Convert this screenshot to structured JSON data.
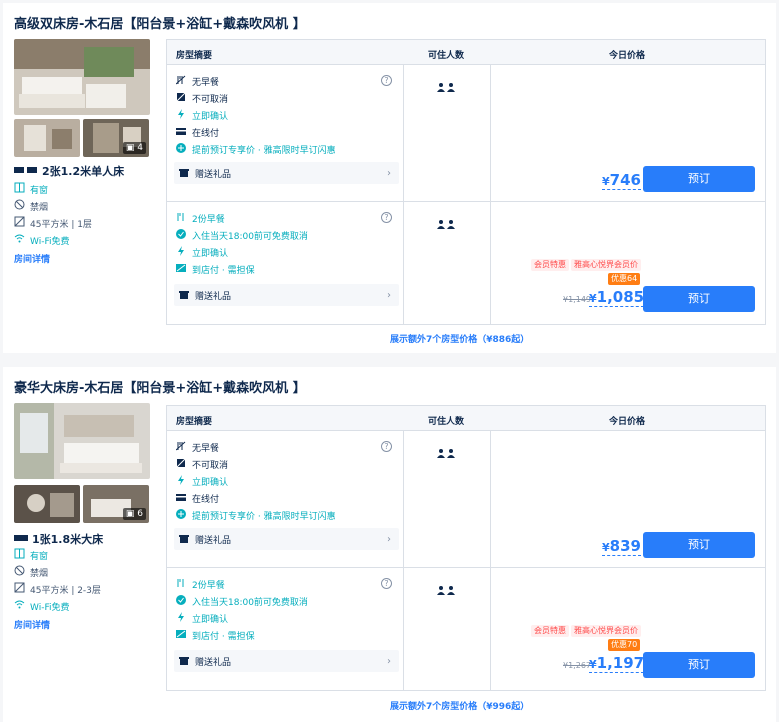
{
  "rooms": [
    {
      "title": "高级双床房-木石居【阳台景+浴缸+戴森吹风机 】",
      "photo_count": "4",
      "bed": "2张1.2米单人床",
      "amenities": [
        {
          "icon": "window-icon",
          "label": "有窗"
        },
        {
          "icon": "no-smoking-icon",
          "label": "禁烟"
        },
        {
          "icon": "area-icon",
          "label": "45平方米 | 1层"
        },
        {
          "icon": "wifi-icon",
          "label": "Wi-Fi免费"
        }
      ],
      "detail_link": "房间详情",
      "header": {
        "summary": "房型摘要",
        "occupancy": "可住人数",
        "price": "今日价格"
      },
      "rates": [
        {
          "policies": [
            {
              "icon": "no-breakfast-icon",
              "label": "无早餐",
              "green": false
            },
            {
              "icon": "no-cancel-icon",
              "label": "不可取消",
              "green": false
            },
            {
              "icon": "lightning-icon",
              "label": "立即确认",
              "green": true
            },
            {
              "icon": "card-icon",
              "label": "在线付",
              "green": false
            },
            {
              "icon": "plus-icon",
              "label": "提前预订专享价 · 雅高限时早订闪惠",
              "green": true
            }
          ],
          "gift": "赠送礼品",
          "price": "746",
          "currency": "¥",
          "book": "预订"
        },
        {
          "policies": [
            {
              "icon": "breakfast-icon",
              "label": "2份早餐",
              "green": true
            },
            {
              "icon": "check-icon",
              "label": "入住当天18:00前可免费取消",
              "green": true
            },
            {
              "icon": "lightning-icon",
              "label": "立即确认",
              "green": true
            },
            {
              "icon": "store-pay-icon",
              "label": "到店付 · 需担保",
              "green": true
            }
          ],
          "gift": "赠送礼品",
          "tags": [
            "会员特惠",
            "雅高心悦界会员价"
          ],
          "discount": "优惠64",
          "orig_price": "¥1,149",
          "price": "1,085",
          "currency": "¥",
          "book": "预订"
        }
      ],
      "more": "展示额外7个房型价格（¥886起）"
    },
    {
      "title": "豪华大床房-木石居【阳台景+浴缸+戴森吹风机 】",
      "photo_count": "6",
      "bed": "1张1.8米大床",
      "amenities": [
        {
          "icon": "window-icon",
          "label": "有窗"
        },
        {
          "icon": "no-smoking-icon",
          "label": "禁烟"
        },
        {
          "icon": "area-icon",
          "label": "45平方米 | 2-3层"
        },
        {
          "icon": "wifi-icon",
          "label": "Wi-Fi免费"
        }
      ],
      "detail_link": "房间详情",
      "header": {
        "summary": "房型摘要",
        "occupancy": "可住人数",
        "price": "今日价格"
      },
      "rates": [
        {
          "policies": [
            {
              "icon": "no-breakfast-icon",
              "label": "无早餐",
              "green": false
            },
            {
              "icon": "no-cancel-icon",
              "label": "不可取消",
              "green": false
            },
            {
              "icon": "lightning-icon",
              "label": "立即确认",
              "green": true
            },
            {
              "icon": "card-icon",
              "label": "在线付",
              "green": false
            },
            {
              "icon": "plus-icon",
              "label": "提前预订专享价 · 雅高限时早订闪惠",
              "green": true
            }
          ],
          "gift": "赠送礼品",
          "price": "839",
          "currency": "¥",
          "book": "预订"
        },
        {
          "policies": [
            {
              "icon": "breakfast-icon",
              "label": "2份早餐",
              "green": true
            },
            {
              "icon": "check-icon",
              "label": "入住当天18:00前可免费取消",
              "green": true
            },
            {
              "icon": "lightning-icon",
              "label": "立即确认",
              "green": true
            },
            {
              "icon": "store-pay-icon",
              "label": "到店付 · 需担保",
              "green": true
            }
          ],
          "gift": "赠送礼品",
          "tags": [
            "会员特惠",
            "雅高心悦界会员价"
          ],
          "discount": "优惠70",
          "orig_price": "¥1,267",
          "price": "1,197",
          "currency": "¥",
          "book": "预订"
        }
      ],
      "more": "展示额外7个房型价格（¥996起）"
    }
  ],
  "colors": {
    "accent": "#287dfa",
    "green": "#06aebd",
    "orange": "#ff7d13",
    "text": "#0f294d"
  }
}
